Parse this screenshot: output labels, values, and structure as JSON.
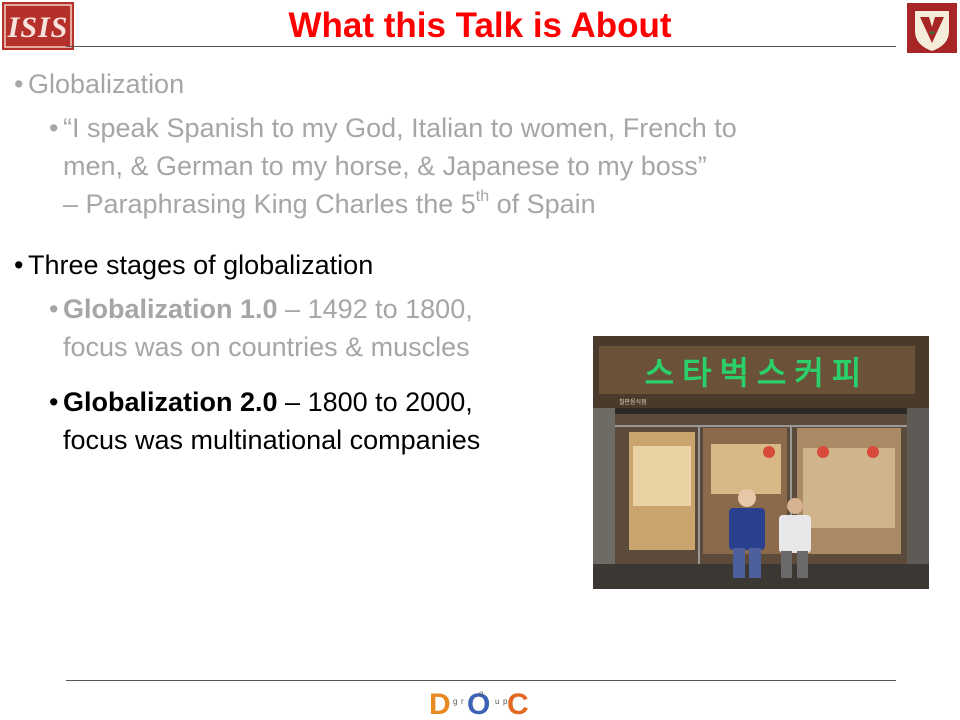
{
  "slide": {
    "title": "What this Talk is About",
    "bullets": {
      "b1": {
        "text": "Globalization"
      },
      "b1_sub": {
        "line1": "“I speak Spanish to my God, Italian to women, French to",
        "line2": "men, & German to my horse, & Japanese to my boss”",
        "line3_pre": "– Paraphrasing King Charles the 5",
        "line3_sup": "th",
        "line3_post": " of Spain"
      },
      "b2": {
        "text": "Three stages of globalization"
      },
      "b2_sub1": {
        "bold": "Globalization 1.0",
        "rest": " – 1492 to 1800,",
        "line2": "focus was on countries & muscles"
      },
      "b2_sub2": {
        "bold": "Globalization 2.0",
        "dash": " – ",
        "rest": "1800 to 2000,",
        "line2": "focus was multinational companies"
      }
    }
  },
  "photo": {
    "sign_text": "스타벅스커피",
    "sign_subtext": "칠판음식점"
  },
  "logos": {
    "isis": "ISIS",
    "doc_letters": [
      "D",
      "O",
      "C"
    ],
    "doc_small": [
      "g",
      "r",
      "o",
      "u",
      "p"
    ]
  },
  "colors": {
    "title": "#ff0000",
    "active_text": "#000000",
    "dimmed_text": "#a6a6a6",
    "vu_shield": "#b22828",
    "sign_text": "#2bd06a"
  }
}
